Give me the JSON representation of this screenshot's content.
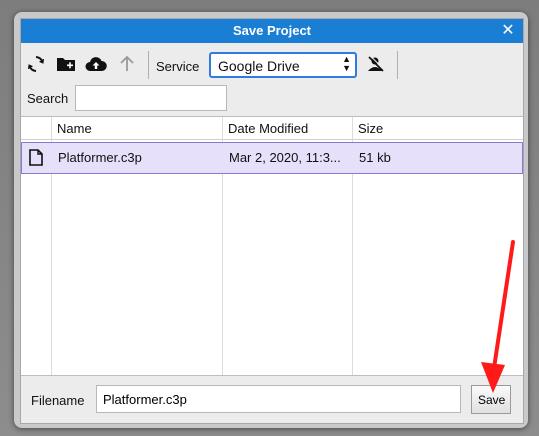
{
  "dialog": {
    "title": "Save Project",
    "close_glyph": "✕"
  },
  "toolbar": {
    "icons": [
      "refresh-icon",
      "new-folder-icon",
      "cloud-upload-icon",
      "up-arrow-icon",
      "sign-out-icon"
    ],
    "service_label": "Service",
    "service_value": "Google Drive"
  },
  "search": {
    "label": "Search",
    "value": ""
  },
  "filelist": {
    "columns": [
      "Name",
      "Date Modified",
      "Size"
    ],
    "rows": [
      {
        "icon": "file-icon",
        "name": "Platformer.c3p",
        "date": "Mar 2, 2020, 11:3...",
        "size": "51 kb"
      }
    ]
  },
  "footer": {
    "filename_label": "Filename",
    "filename_value": "Platformer.c3p",
    "save_label": "Save"
  },
  "colors": {
    "titlebar": "#1a7fd4",
    "selection": "#e6e0fa",
    "annotation_arrow": "#ff0000"
  }
}
